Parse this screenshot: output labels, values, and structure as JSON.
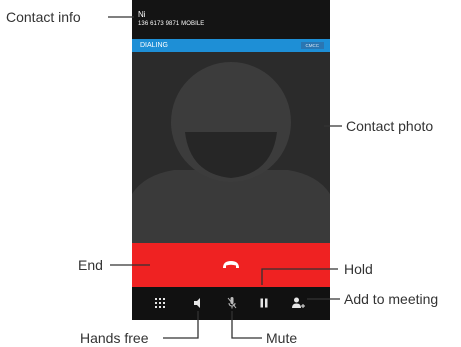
{
  "contact": {
    "name": "Ni",
    "number": "136 6173 9871  MOBILE"
  },
  "status": {
    "text": "DIALING",
    "carrier": "CMCC"
  },
  "annotations": {
    "contact_info": "Contact info",
    "contact_photo": "Contact photo",
    "end": "End",
    "hold": "Hold",
    "add_to_meeting": "Add to meeting",
    "hands_free": "Hands free",
    "mute": "Mute"
  },
  "icons": {
    "end": "phone-hangup-icon",
    "dialpad": "dialpad-icon",
    "speaker": "speaker-icon",
    "mute": "microphone-mute-icon",
    "hold": "pause-icon",
    "add": "add-person-icon",
    "avatar": "default-avatar-icon"
  },
  "colors": {
    "dialing_bar": "#1e8fd6",
    "end_bar": "#ef2222",
    "header_bg": "#141414",
    "controls_bg": "#111111"
  }
}
